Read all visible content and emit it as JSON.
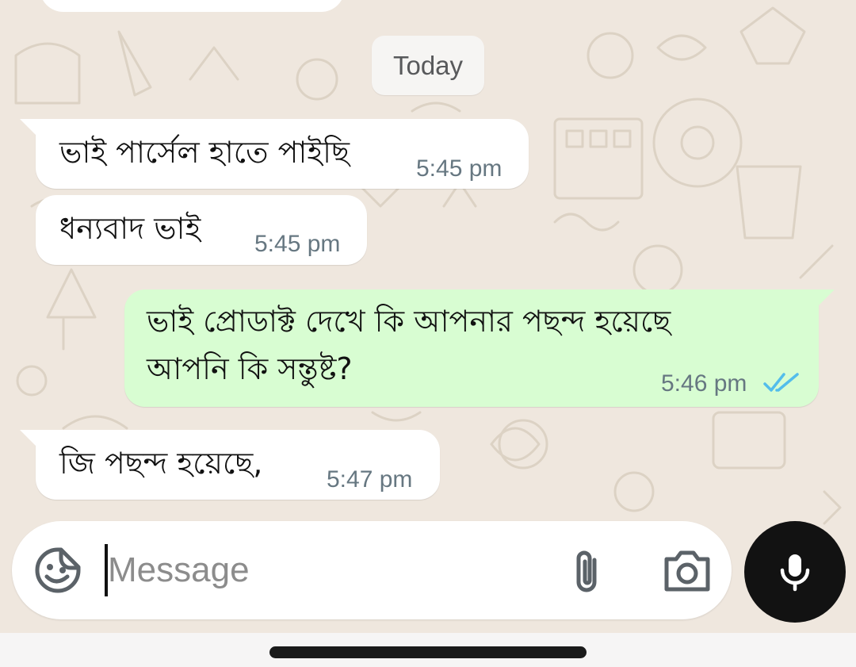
{
  "chat": {
    "date_chip": "Today",
    "messages": [
      {
        "direction": "incoming",
        "text": "ভাই পার্সেল হাতে পাইছি",
        "time": "5:45 pm"
      },
      {
        "direction": "incoming",
        "text": "ধন্যবাদ ভাই",
        "time": "5:45 pm"
      },
      {
        "direction": "outgoing",
        "lines": [
          "ভাই প্রোডাক্ট দেখে কি আপনার পছন্দ হয়েছে",
          "আপনি কি সন্তুষ্ট?"
        ],
        "time": "5:46 pm",
        "status": "read"
      },
      {
        "direction": "incoming",
        "text": "জি পছন্দ হয়েছে,",
        "time": "5:47 pm"
      }
    ]
  },
  "composer": {
    "placeholder": "Message",
    "icons": {
      "emoji": "sticker-emoji-icon",
      "attach": "paperclip-icon",
      "camera": "camera-icon",
      "mic": "microphone-icon"
    }
  },
  "colors": {
    "wallpaper": "#efe7de",
    "incoming_bubble": "#ffffff",
    "outgoing_bubble": "#d8fdd2",
    "read_ticks": "#53bdeb",
    "mic_button": "#121212"
  }
}
